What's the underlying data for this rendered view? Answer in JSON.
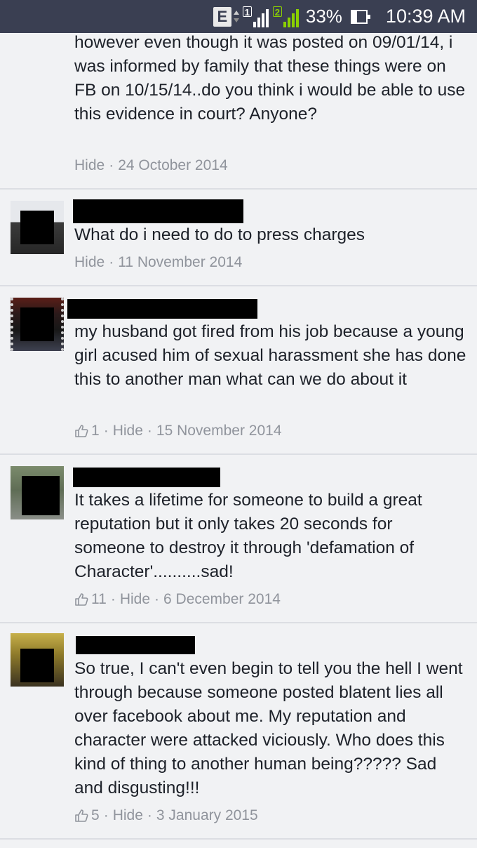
{
  "status_bar": {
    "network": "E",
    "sim1": "1",
    "sim2": "2",
    "battery": "33%",
    "time": "10:39 AM"
  },
  "comments": [
    {
      "text": "however even though it was posted on 09/01/14, i was informed by family that these things were on FB on 10/15/14..do you think i would be able to use this evidence in court? Anyone?",
      "likes": "",
      "hide_label": "Hide",
      "date": "24 October 2014"
    },
    {
      "text": "What do i need to do to press charges",
      "likes": "",
      "hide_label": "Hide",
      "date": "11 November 2014"
    },
    {
      "text": "my husband got fired from his job because a young girl acused him of sexual harassment she has done this to another man what can we do about it",
      "likes": "1",
      "hide_label": "Hide",
      "date": "15 November 2014"
    },
    {
      "text": "It takes a lifetime for someone to build a great reputation but it only takes 20 seconds for someone to destroy it through 'defamation of Character'..........sad!",
      "likes": "11",
      "hide_label": "Hide",
      "date": "6 December 2014"
    },
    {
      "text": "So true, I can't even begin to tell you the hell I went through because someone posted blatent lies all over facebook about me. My reputation and character were attacked viciously. Who does this kind of thing to another human being????? Sad and disgusting!!!",
      "likes": "5",
      "hide_label": "Hide",
      "date": "3 January 2015"
    }
  ],
  "separator": "·",
  "icons": {
    "like": "thumbs-up-icon",
    "battery": "battery-icon",
    "signal": "signal-bars-icon"
  },
  "colors": {
    "status_bar_bg": "#3a3f52",
    "page_bg": "#f1f2f4",
    "meta_text": "#90949c",
    "sim2_signal": "#8bd000"
  }
}
